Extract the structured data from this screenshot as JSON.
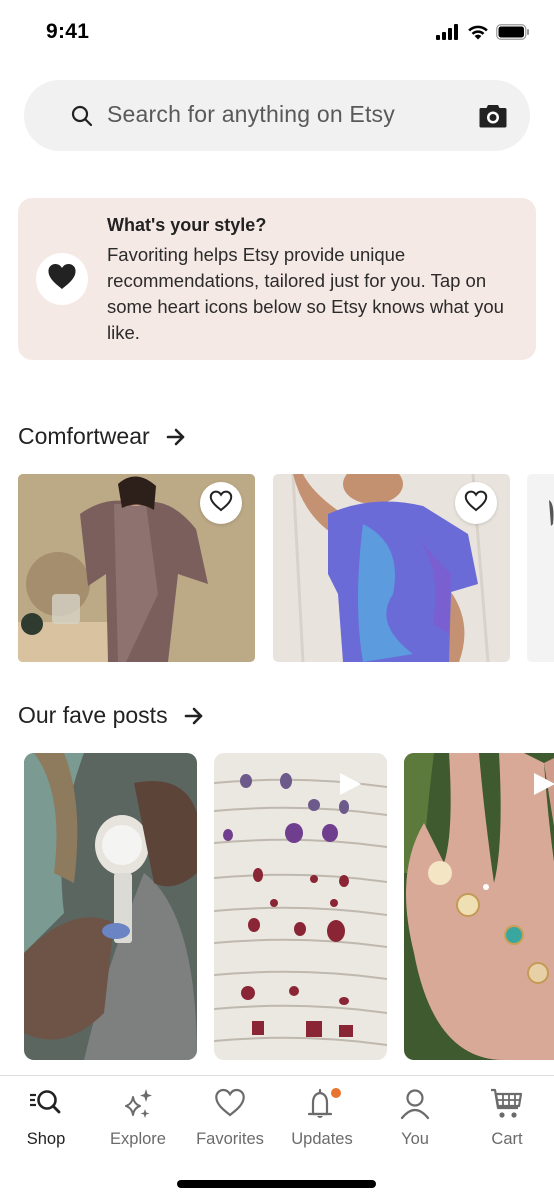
{
  "status_bar": {
    "time": "9:41",
    "icons": [
      "cellular-signal-icon",
      "wifi-icon",
      "battery-icon"
    ]
  },
  "search": {
    "placeholder": "Search for anything on Etsy",
    "left_icon": "search-icon",
    "right_icon": "camera-icon"
  },
  "style_prompt": {
    "icon": "heart-filled-icon",
    "title": "What's your style?",
    "body": "Favoriting helps Etsy provide unique recommendations, tailored just for you. Tap on some heart icons below so Etsy knows what you like."
  },
  "sections": [
    {
      "title": "Comfortwear",
      "arrow_icon": "arrow-right-icon",
      "items": [
        {
          "type": "listing",
          "image": "woman-in-mauve-linen-robe",
          "favorite_icon": "heart-outline-icon"
        },
        {
          "type": "listing",
          "image": "purple-blue-tie-dye-t-shirt",
          "favorite_icon": "heart-outline-icon"
        },
        {
          "type": "listing",
          "image": "partially-visible-listing"
        }
      ]
    },
    {
      "title": "Our fave posts",
      "arrow_icon": "arrow-right-icon",
      "items": [
        {
          "type": "post",
          "image": "hands-measuring-with-dial-caliper"
        },
        {
          "type": "post",
          "image": "ring-display-tray-with-gemstones",
          "media_icon": "play-icon"
        },
        {
          "type": "post",
          "image": "hand-wearing-gold-rings",
          "media_icon": "play-icon"
        }
      ]
    }
  ],
  "tab_bar": {
    "active": "Shop",
    "tabs": [
      {
        "label": "Shop",
        "icon": "shop-search-icon",
        "active": true
      },
      {
        "label": "Explore",
        "icon": "sparkles-icon",
        "active": false
      },
      {
        "label": "Favorites",
        "icon": "heart-outline-icon",
        "active": false
      },
      {
        "label": "Updates",
        "icon": "bell-icon",
        "active": false,
        "badge": true
      },
      {
        "label": "You",
        "icon": "person-icon",
        "active": false
      },
      {
        "label": "Cart",
        "icon": "cart-icon",
        "active": false
      }
    ]
  },
  "colors": {
    "accent_badge": "#e8742f",
    "style_card_bg": "#f5e9e5",
    "search_bg": "#f1f1f1",
    "text_primary": "#222222",
    "text_muted": "#6b6b6b"
  }
}
